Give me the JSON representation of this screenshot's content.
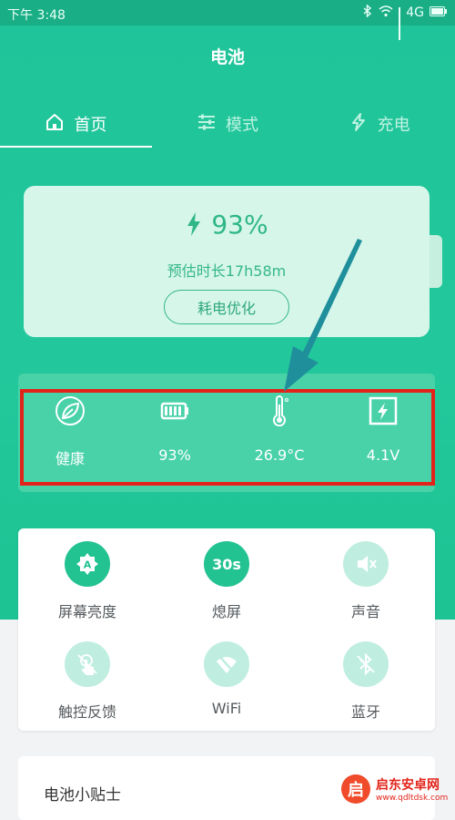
{
  "status_bar": {
    "time": "下午 3:48",
    "network": "4G"
  },
  "app": {
    "title": "电池"
  },
  "tabs": [
    {
      "label": "首页",
      "icon": "home-icon",
      "active": true
    },
    {
      "label": "模式",
      "icon": "sliders-icon",
      "active": false
    },
    {
      "label": "充电",
      "icon": "lightning-icon",
      "active": false
    }
  ],
  "battery": {
    "percent": "93%",
    "estimate": "预估时长17h58m",
    "optimize_label": "耗电优化"
  },
  "stats": [
    {
      "icon": "leaf-icon",
      "label": "健康"
    },
    {
      "icon": "battery-icon",
      "label": "93%"
    },
    {
      "icon": "thermometer-icon",
      "label": "26.9°C"
    },
    {
      "icon": "voltage-icon",
      "label": "4.1V"
    }
  ],
  "quick_settings": [
    {
      "label": "屏幕亮度",
      "icon": "brightness-icon",
      "enabled": true
    },
    {
      "label": "熄屏",
      "icon": "timer-icon",
      "icon_text": "30s",
      "enabled": true
    },
    {
      "label": "声音",
      "icon": "mute-icon",
      "enabled": false
    },
    {
      "label": "触控反馈",
      "icon": "touch-icon",
      "enabled": false
    },
    {
      "label": "WiFi",
      "icon": "wifi-off-icon",
      "enabled": false
    },
    {
      "label": "蓝牙",
      "icon": "bluetooth-icon",
      "enabled": false
    }
  ],
  "tips": {
    "title": "电池小贴士"
  },
  "watermark": {
    "logo": "启",
    "name": "启东安卓网",
    "url": "www.qdltdsk.com"
  },
  "colors": {
    "primary": "#22c89b",
    "highlight": "#e2231a",
    "arrow": "#1f8f9c"
  }
}
